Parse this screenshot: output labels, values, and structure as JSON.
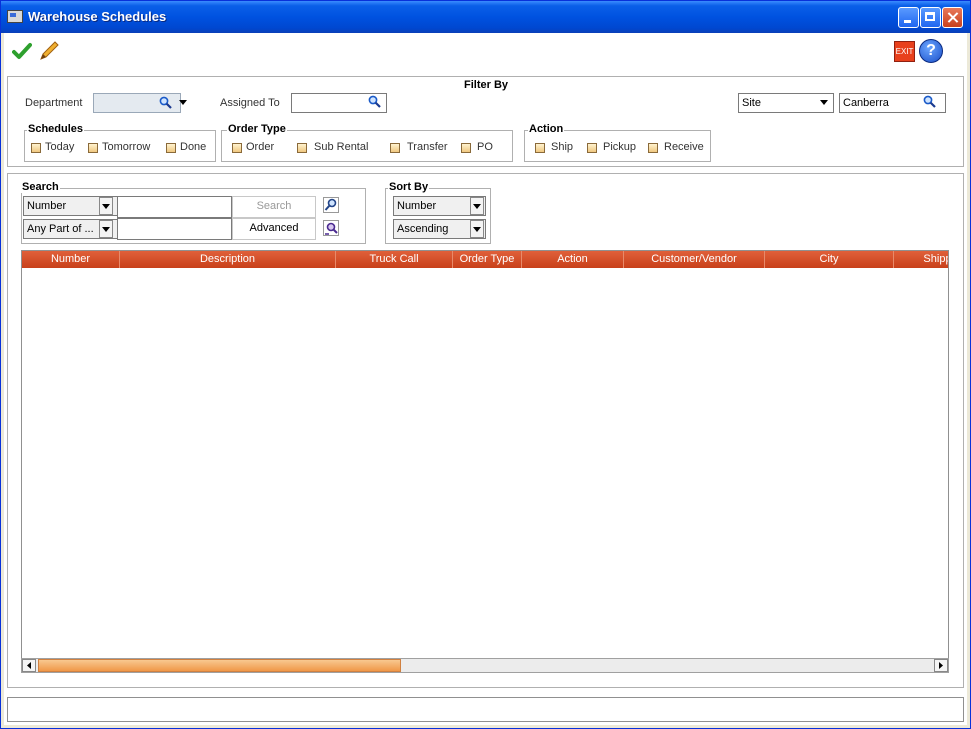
{
  "window": {
    "title": "Warehouse Schedules"
  },
  "toolbar": {
    "exit_label": "EXIT",
    "help_label": "?"
  },
  "filter": {
    "title": "Filter By",
    "department_label": "Department",
    "department_value": "",
    "assigned_to_label": "Assigned To",
    "assigned_to_value": "",
    "site_select": "Site",
    "site_value": "Canberra",
    "schedules": {
      "title": "Schedules",
      "options": [
        "Today",
        "Tomorrow",
        "Done"
      ]
    },
    "order_type": {
      "title": "Order Type",
      "options": [
        "Order",
        "Sub Rental",
        "Transfer",
        "PO"
      ]
    },
    "action": {
      "title": "Action",
      "options": [
        "Ship",
        "Pickup",
        "Receive"
      ]
    }
  },
  "search": {
    "title": "Search",
    "field_select": "Number",
    "match_select": "Any Part of ...",
    "query_value": "",
    "query2_value": "",
    "search_button": "Search",
    "advanced_button": "Advanced"
  },
  "sort": {
    "title": "Sort By",
    "field_select": "Number",
    "order_select": "Ascending"
  },
  "grid": {
    "columns": [
      "Number",
      "Description",
      "Truck Call",
      "Order Type",
      "Action",
      "Customer/Vendor",
      "City",
      "Shippi"
    ],
    "rows": []
  },
  "colors": {
    "header": "#d0502a",
    "scroll_thumb": "#f4a858",
    "titlebar": "#0052e0"
  }
}
